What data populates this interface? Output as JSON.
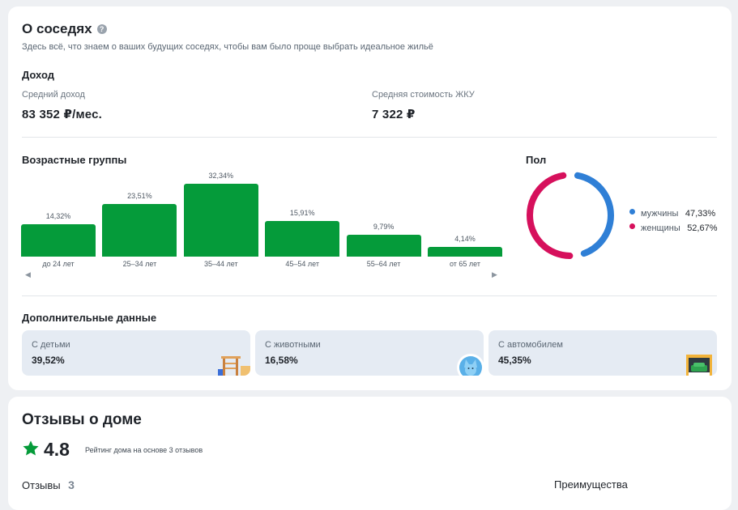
{
  "neighbors": {
    "title": "О соседях",
    "help_icon": "?",
    "subtitle": "Здесь всё, что знаем о ваших будущих соседях, чтобы вам было проще выбрать идеальное жильё",
    "income": {
      "title": "Доход",
      "avg_income_label": "Средний доход",
      "avg_income_value": "83 352 ₽/мес.",
      "avg_utility_label": "Средняя стоимость ЖКУ",
      "avg_utility_value": "7 322 ₽"
    },
    "age": {
      "title": "Возрастные группы",
      "scroll_left": "◀",
      "scroll_right": "▶"
    },
    "gender": {
      "title": "Пол",
      "male_label": "мужчины",
      "male_value": "47,33%",
      "female_label": "женщины",
      "female_value": "52,67%",
      "male_color": "#2f7fd6",
      "female_color": "#d6105c"
    },
    "extra": {
      "title": "Дополнительные данные",
      "items": [
        {
          "label": "С детьми",
          "value": "39,52%",
          "icon": "playground-icon"
        },
        {
          "label": "С животными",
          "value": "16,58%",
          "icon": "cat-icon"
        },
        {
          "label": "С автомобилем",
          "value": "45,35%",
          "icon": "garage-car-icon"
        }
      ]
    }
  },
  "reviews": {
    "title": "Отзывы о доме",
    "rating": "4.8",
    "rating_desc": "Рейтинг дома на основе 3 отзывов",
    "reviews_label": "Отзывы",
    "reviews_count": "3",
    "advantages_label": "Преимущества",
    "star_color": "#059b3a"
  },
  "chart_data": {
    "type": "bar",
    "categories": [
      "до 24 лет",
      "25–34 лет",
      "35–44 лет",
      "45–54 лет",
      "55–64 лет",
      "от 65 лет"
    ],
    "values": [
      14.32,
      23.51,
      32.34,
      15.91,
      9.79,
      4.14
    ],
    "value_labels": [
      "14,32%",
      "23,51%",
      "32,34%",
      "15,91%",
      "9,79%",
      "4,14%"
    ],
    "title": "Возрастные группы",
    "xlabel": "",
    "ylabel": "",
    "ylim": [
      0,
      32.34
    ],
    "grid": false,
    "bar_color": "#059b3a"
  }
}
